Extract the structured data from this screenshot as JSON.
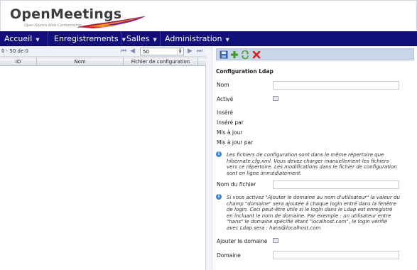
{
  "app": {
    "logo_title": "OpenMeetings",
    "logo_subtitle": "Open-Source Web-Conferencing"
  },
  "nav": {
    "items": [
      {
        "label": "Accueil"
      },
      {
        "label": "Enregistrements"
      },
      {
        "label": "Salles"
      },
      {
        "label": "Administration"
      }
    ]
  },
  "list": {
    "count": "0 - 50 de 0",
    "page_size": "50",
    "columns": [
      "ID",
      "Nom",
      "Fichier de configuration"
    ]
  },
  "form": {
    "title": "Configuration Ldap",
    "name_label": "Nom",
    "active_label": "Activé",
    "inserted_label": "Inséré",
    "inserted_by_label": "Inséré par",
    "updated_label": "Mis à jour",
    "updated_by_label": "Mis à jour par",
    "info1": "Les fichiers de configuration sont dans le même répertoire que hibernate.cfg.xml. Vous devez charger manuellement les fichiers vers ce répertoire. Les modifications dans le fichier de configuration sont en ligne immédiatement.",
    "file_name_label": "Nom du fichier",
    "info2": "Si vous activez \"Ajouter le domaine au nom d'utilisateur\" la valeur du champ \"domaine\" sera ajoutée à chaque login entré dans la fenêtre de login. Ceci peut-être utile si le login dans le Ldap est enregistré en incluant le nom de domaine.  Par exemple : un utilisateur entre \"hans\" le domaine spécifié étant \"localhost.com\", le login vérifié avec Ldap sera : hans@localhost.com",
    "add_domain_label": "Ajouter le domaine",
    "domain_label": "Domaine"
  },
  "colors": {
    "navbar": "#120f7a",
    "toolbar": "#c9d6e8",
    "info": "#3a86d6"
  },
  "icons": [
    "feather-logo",
    "first-page-icon",
    "prev-page-icon",
    "next-page-icon",
    "last-page-icon",
    "save-icon",
    "add-icon",
    "refresh-icon",
    "delete-icon",
    "info-icon"
  ]
}
